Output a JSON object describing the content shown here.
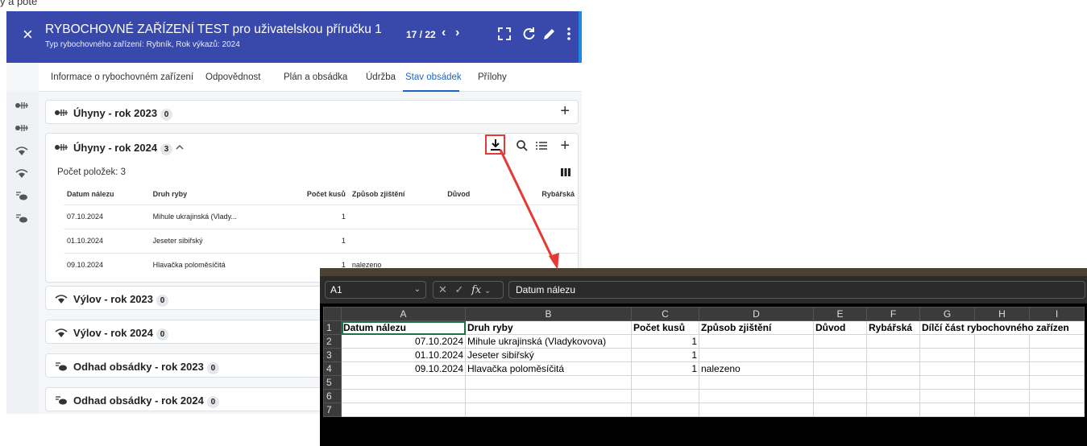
{
  "app": {
    "title": "RYBOCHOVNÉ ZAŘÍZENÍ TEST pro uživatelskou příručku 1",
    "subtitle": "Typ rybochovného zařízení: Rybník, Rok výkazů: 2024",
    "pager": "17 / 22",
    "close_icon": "×",
    "prev_icon": "‹",
    "next_icon": "›",
    "colors": {
      "header": "#3949ab",
      "accent": "#1e63c4",
      "highlight": "#e53935"
    }
  },
  "tabs": [
    {
      "label": "Informace o rybochovném zařízení"
    },
    {
      "label": "Odpovědnost"
    },
    {
      "label": "Plán a obsádka"
    },
    {
      "label": "Údržba"
    },
    {
      "label": "Stav obsádek",
      "active": true
    },
    {
      "label": "Přílohy"
    }
  ],
  "sections": [
    {
      "title": "Úhyny - rok 2023",
      "count": "0",
      "icon": "fish-skeleton-icon"
    },
    {
      "title": "Úhyny - rok 2024",
      "count": "3",
      "icon": "fish-skeleton-icon",
      "expanded": true
    },
    {
      "title": "Výlov - rok 2023",
      "count": "0",
      "icon": "fishing-net-icon"
    },
    {
      "title": "Výlov - rok 2024",
      "count": "0",
      "icon": "fishing-net-icon"
    },
    {
      "title": "Odhad obsádky - rok 2023",
      "count": "0",
      "icon": "fish-estimate-icon"
    },
    {
      "title": "Odhad obsádky - rok 2024",
      "count": "0",
      "icon": "fish-estimate-icon"
    }
  ],
  "grid": {
    "item_count": "Počet položek: 3",
    "columns": [
      "Datum nálezu",
      "Druh ryby",
      "Počet kusů",
      "Způsob zjištění",
      "Důvod",
      "Rybářská"
    ],
    "rows": [
      [
        "07.10.2024",
        "Mihule ukrajinská (Vlady...",
        "1",
        ""
      ],
      [
        "01.10.2024",
        "Jeseter sibiřský",
        "1",
        ""
      ],
      [
        "09.10.2024",
        "Hlavačka poloměsíčitá",
        "1",
        "nalezeno"
      ]
    ]
  },
  "excel": {
    "name_box": "A1",
    "fx_label": "fx",
    "formula": "Datum nálezu",
    "col_letters": [
      "A",
      "B",
      "C",
      "D",
      "E",
      "F",
      "G",
      "H",
      "I"
    ],
    "row_numbers": [
      "1",
      "2",
      "3",
      "4",
      "5",
      "6",
      "7"
    ],
    "header_row": [
      "Datum nálezu",
      "Druh ryby",
      "Počet kusů",
      "Způsob zjištění",
      "Důvod",
      "Rybářská",
      "Dílčí část rybochovného zařízen"
    ],
    "rows": [
      [
        "07.10.2024",
        "Mihule ukrajinská (Vladykovova)",
        "1",
        ""
      ],
      [
        "01.10.2024",
        "Jeseter sibiřský",
        "1",
        ""
      ],
      [
        "09.10.2024",
        "Hlavačka poloměsíčitá",
        "1",
        "nalezeno"
      ]
    ]
  },
  "cut_text": "ý a poté ...."
}
